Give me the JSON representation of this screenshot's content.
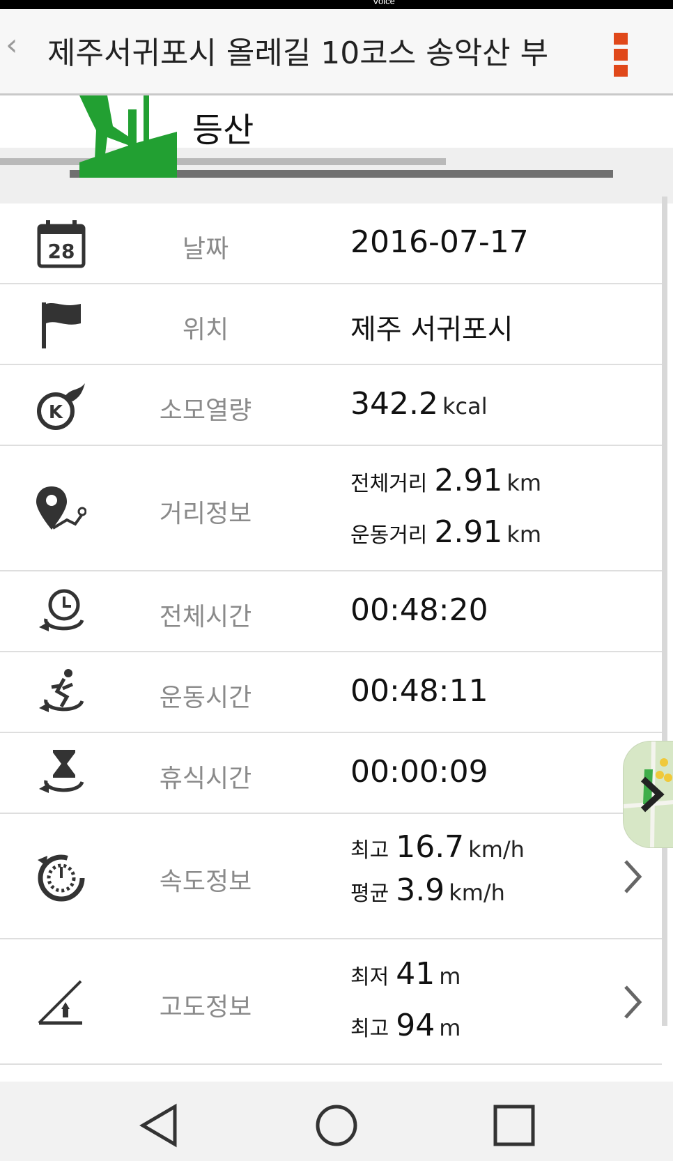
{
  "status": {
    "text": "Voice"
  },
  "appbar": {
    "title": "제주서귀포시 올레길 10코스 송악산 부"
  },
  "header": {
    "activity": "등산"
  },
  "rows": {
    "date": {
      "label": "날짜",
      "value": "2016-07-17",
      "icon_day": "28"
    },
    "location": {
      "label": "위치",
      "value": "제주 서귀포시"
    },
    "calories": {
      "label": "소모열량",
      "value": "342.2",
      "unit": "kcal"
    },
    "distance": {
      "label": "거리정보",
      "total_label": "전체거리",
      "total_value": "2.91",
      "total_unit": "km",
      "exercise_label": "운동거리",
      "exercise_value": "2.91",
      "exercise_unit": "km"
    },
    "total_time": {
      "label": "전체시간",
      "value": "00:48:20"
    },
    "exercise_time": {
      "label": "운동시간",
      "value": "00:48:11"
    },
    "rest_time": {
      "label": "휴식시간",
      "value": "00:00:09"
    },
    "speed": {
      "label": "속도정보",
      "max_label": "최고",
      "max_value": "16.7",
      "max_unit": "km/h",
      "avg_label": "평균",
      "avg_value": "3.9",
      "avg_unit": "km/h"
    },
    "altitude": {
      "label": "고도정보",
      "min_label": "최저",
      "min_value": "41",
      "min_unit": "m",
      "max_label": "최고",
      "max_value": "94",
      "max_unit": "m"
    }
  },
  "colors": {
    "accent": "#e0481a",
    "hiking_green": "#22a032",
    "label_gray": "#8a8a8a"
  },
  "icons": [
    "back-icon",
    "more-icon",
    "hiking-icon",
    "calendar-icon",
    "flag-icon",
    "calorie-icon",
    "distance-pin-icon",
    "clock-icon",
    "runner-icon",
    "hourglass-icon",
    "speedometer-icon",
    "altitude-icon",
    "chevron-right-icon",
    "map-thumbnail",
    "nav-back-icon",
    "nav-home-icon",
    "nav-recents-icon"
  ]
}
